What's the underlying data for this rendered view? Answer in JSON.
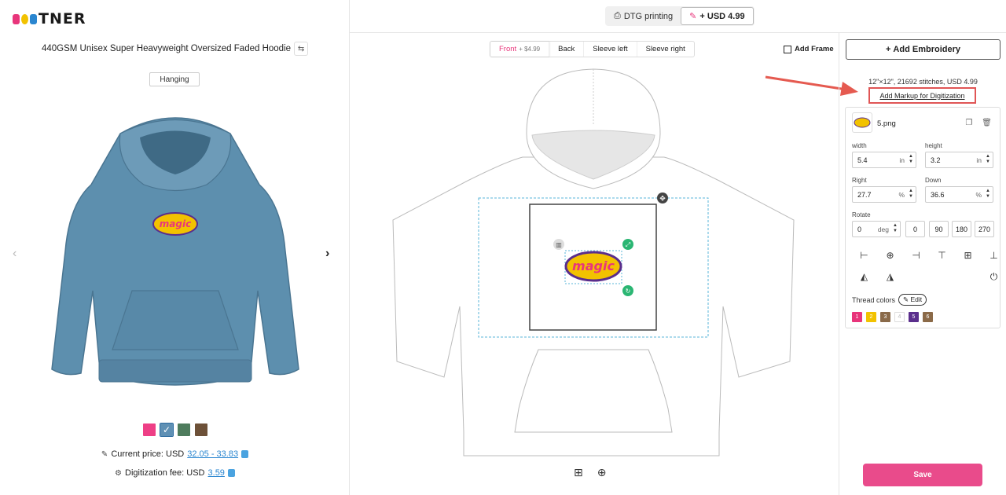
{
  "brand": {
    "logo_text": "TNER",
    "dot_colors": [
      "#e8357b",
      "#f2c200",
      "#2a86d0"
    ]
  },
  "product": {
    "title": "440GSM Unisex Super Heavyweight Oversized Faded Hoodie",
    "view_tag": "Hanging"
  },
  "preview": {
    "garment_color": "#5d8fae",
    "design_text": "magic"
  },
  "color_swatches": [
    {
      "color": "#ee3f86",
      "selected": false
    },
    {
      "color": "#5f90b4",
      "selected": true
    },
    {
      "color": "#4e7c5d",
      "selected": false
    },
    {
      "color": "#6d5138",
      "selected": false
    }
  ],
  "pricing": {
    "current_price_label": "Current price: USD",
    "current_price_value": "32.05 - 33.83",
    "digitization_label": "Digitization fee: USD",
    "digitization_value": "3.59"
  },
  "methods": [
    {
      "label": "DTG printing",
      "active": false
    },
    {
      "label": "+ USD 4.99",
      "active": true
    }
  ],
  "side_tabs": [
    {
      "label": "Front",
      "suffix": "+ $4.99",
      "active": true
    },
    {
      "label": "Back",
      "suffix": "",
      "active": false
    },
    {
      "label": "Sleeve left",
      "suffix": "",
      "active": false
    },
    {
      "label": "Sleeve right",
      "suffix": "",
      "active": false
    }
  ],
  "add_frame_label": "Add Frame",
  "right": {
    "add_embroidery_label": "Add Embroidery",
    "spec_line": "12\"×12\",   21692 stitches,   USD 4.99",
    "markup_link": "Add Markup for Digitization",
    "file_name": "5.png",
    "width_label": "width",
    "width_value": "5.4",
    "width_unit": "in",
    "height_label": "height",
    "height_value": "3.2",
    "height_unit": "in",
    "right_label": "Right",
    "right_value": "27.7",
    "right_unit": "%",
    "down_label": "Down",
    "down_value": "36.6",
    "down_unit": "%",
    "rotate_label": "Rotate",
    "rotate_value": "0",
    "rotate_unit": "deg",
    "rotate_presets": [
      "0",
      "90",
      "180",
      "270"
    ],
    "thread_colors_label": "Thread colors",
    "edit_label": "Edit",
    "threads": [
      {
        "label": "1",
        "color": "#e8357b"
      },
      {
        "label": "2",
        "color": "#f2c200"
      },
      {
        "label": "3",
        "color": "#8a6a4a"
      },
      {
        "label": "4",
        "color": "#ffffff"
      },
      {
        "label": "5",
        "color": "#5a2e8c"
      },
      {
        "label": "6",
        "color": "#8b6a48"
      }
    ],
    "save_label": "Save"
  }
}
